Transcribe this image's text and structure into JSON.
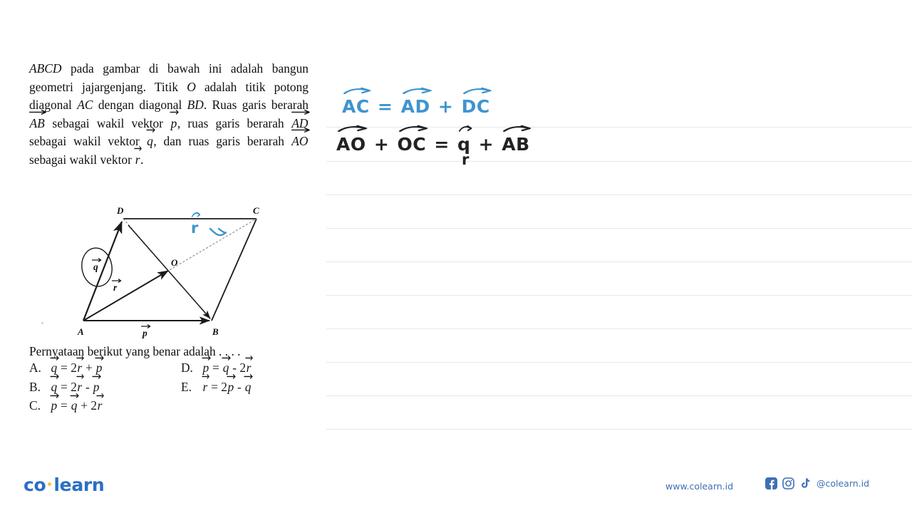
{
  "question": {
    "paragraph_html": "<i>ABCD</i> pada gambar di bawah ini adalah bangun geometri jajargenjang. Titik <i>O</i> adalah titik potong diagonal <i>AC</i> dengan diagonal <i>BD</i>. Ruas garis berarah <b>AB</b> sebagai wakil vektor <b>p</b>, ruas garis berarah <b>AD</b> sebagai wakil vektor <b>q</b>, dan ruas garis berarah <b>AO</b> sebagai wakil vektor <b>r</b>.",
    "text_plain": "ABCD pada gambar di bawah ini adalah bangun geometri jajargenjang. Titik O adalah titik potong diagonal AC dengan diagonal BD. Ruas garis berarah AB sebagai wakil vektor p, ruas garis berarah AD sebagai wakil vektor q, dan ruas garis berarah AO sebagai wakil vektor r.",
    "prompt": "Pernyataan berikut yang benar adalah . . . ."
  },
  "figure": {
    "vertices": [
      "D",
      "C",
      "O",
      "A",
      "B"
    ],
    "vector_labels": [
      "q",
      "r",
      "p"
    ],
    "circled_label": "q",
    "annotation_letter": "r",
    "annotation_color": "#3f94cf"
  },
  "options": [
    {
      "letter": "A.",
      "lhs": "q",
      "rhs": "= 2r + p",
      "column": 0
    },
    {
      "letter": "B.",
      "lhs": "q",
      "rhs": "= 2r - p",
      "column": 0
    },
    {
      "letter": "C.",
      "lhs": "p",
      "rhs": "= q + 2r",
      "column": 0
    },
    {
      "letter": "D.",
      "lhs": "p",
      "rhs": "= q - 2r",
      "column": 1
    },
    {
      "letter": "E.",
      "lhs": "r",
      "rhs": "= 2p - q",
      "column": 1
    }
  ],
  "handwriting": {
    "line1": {
      "text": "AC = AD + DC",
      "color": "#3f94cf"
    },
    "line2": {
      "text": "AO + OC = q + AB",
      "color": "#222222"
    },
    "subscript_note": "r"
  },
  "ruled_lines_y": [
    178,
    226,
    273,
    320,
    367,
    414,
    461,
    508,
    555,
    602
  ],
  "footer": {
    "logo_part1": "co",
    "logo_part2": "learn",
    "website": "www.colearn.id",
    "handle": "@colearn.id",
    "icons": [
      "facebook-icon",
      "instagram-icon",
      "tiktok-icon"
    ],
    "brand_color": "#2b6fc4",
    "dot_color": "#f5c344"
  }
}
